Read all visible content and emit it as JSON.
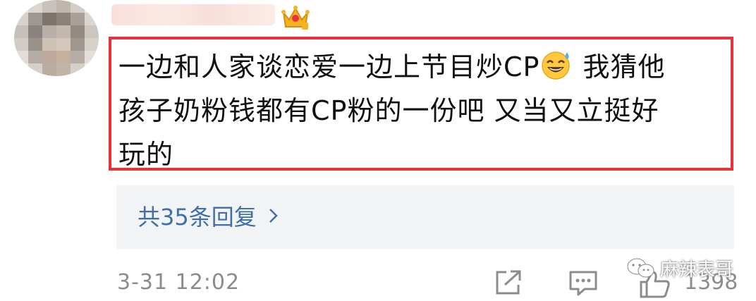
{
  "comment": {
    "line1_a": "一边和人家谈恋爱一边上节目炒CP",
    "line1_b": " 我猜他",
    "line2": "孩子奶粉钱都有CP粉的一份吧 又当又立挺好",
    "line3": "玩的"
  },
  "replies": {
    "label": "共35条回复"
  },
  "footer": {
    "timestamp": "3-31 12:02",
    "like_count": "1398"
  },
  "watermark": {
    "text": "麻辣表哥"
  },
  "colors": {
    "highlight_border": "#e8323a",
    "link": "#3f6ea8",
    "muted": "#8c8c8c",
    "panel": "#f2f3f5"
  },
  "icons": {
    "crown": "crown-badge-icon",
    "emoji": "grinning-sweat-emoji",
    "share": "share-icon",
    "comment": "comment-icon",
    "like": "thumbs-up-icon",
    "watermark": "wechat-icon",
    "chevron": "chevron-right-icon"
  }
}
